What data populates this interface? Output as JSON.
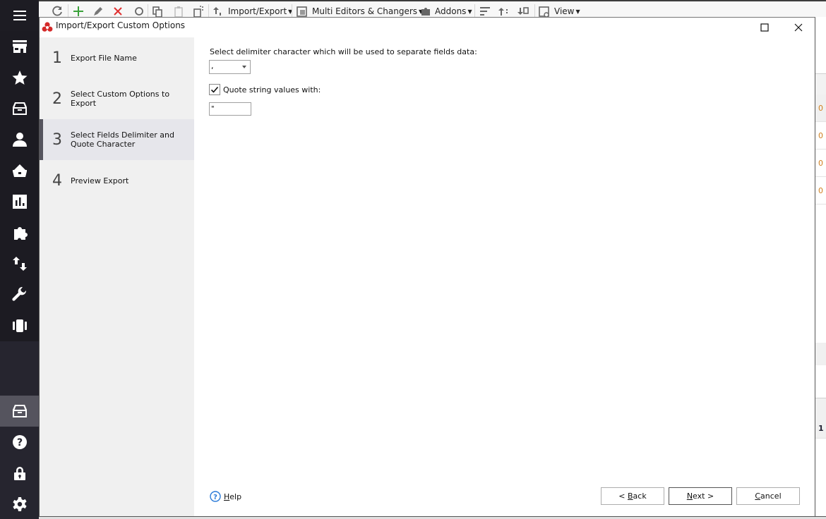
{
  "app_nav": {
    "items": [
      {
        "name": "menu",
        "icon": "hamburger-icon"
      },
      {
        "name": "store",
        "icon": "store-icon"
      },
      {
        "name": "favorites",
        "icon": "star-icon"
      },
      {
        "name": "products",
        "icon": "archive-box-icon"
      },
      {
        "name": "customers",
        "icon": "user-icon"
      },
      {
        "name": "orders",
        "icon": "basket-icon"
      },
      {
        "name": "reports",
        "icon": "bar-chart-icon"
      },
      {
        "name": "addons",
        "icon": "puzzle-icon"
      },
      {
        "name": "import-export",
        "icon": "arrows-up-down-icon"
      },
      {
        "name": "tools",
        "icon": "wrench-icon"
      },
      {
        "name": "carousel",
        "icon": "carousel-icon"
      },
      {
        "name": "product-manager",
        "icon": "archive-box-icon",
        "active": true
      },
      {
        "name": "help",
        "icon": "question-circle-icon"
      },
      {
        "name": "license",
        "icon": "lock-icon"
      },
      {
        "name": "settings",
        "icon": "gear-icon"
      }
    ]
  },
  "toolbar": {
    "import_export": "Import/Export",
    "multi_editors": "Multi Editors & Changers",
    "addons": "Addons",
    "view": "View"
  },
  "background_grid": {
    "values": [
      "0",
      "0",
      "0",
      "0",
      "1"
    ]
  },
  "dialog": {
    "title": "Import/Export Custom Options",
    "steps": [
      {
        "number": "1",
        "label": "Export File Name"
      },
      {
        "number": "2",
        "label": "Select Custom Options to Export"
      },
      {
        "number": "3",
        "label": "Select Fields Delimiter and Quote Character",
        "active": true
      },
      {
        "number": "4",
        "label": "Preview Export"
      }
    ],
    "delimiter_label": "Select delimiter character which will be used to separate fields data:",
    "delimiter_value": ",",
    "quote_checkbox_label": "Quote string values with:",
    "quote_checked": true,
    "quote_value": "\"",
    "help_label_underlined": "H",
    "help_label_rest": "elp",
    "back_prefix": "< ",
    "back_underlined": "B",
    "back_rest": "ack",
    "next_underlined": "N",
    "next_rest": "ext >",
    "cancel_underlined": "C",
    "cancel_rest": "ancel"
  }
}
